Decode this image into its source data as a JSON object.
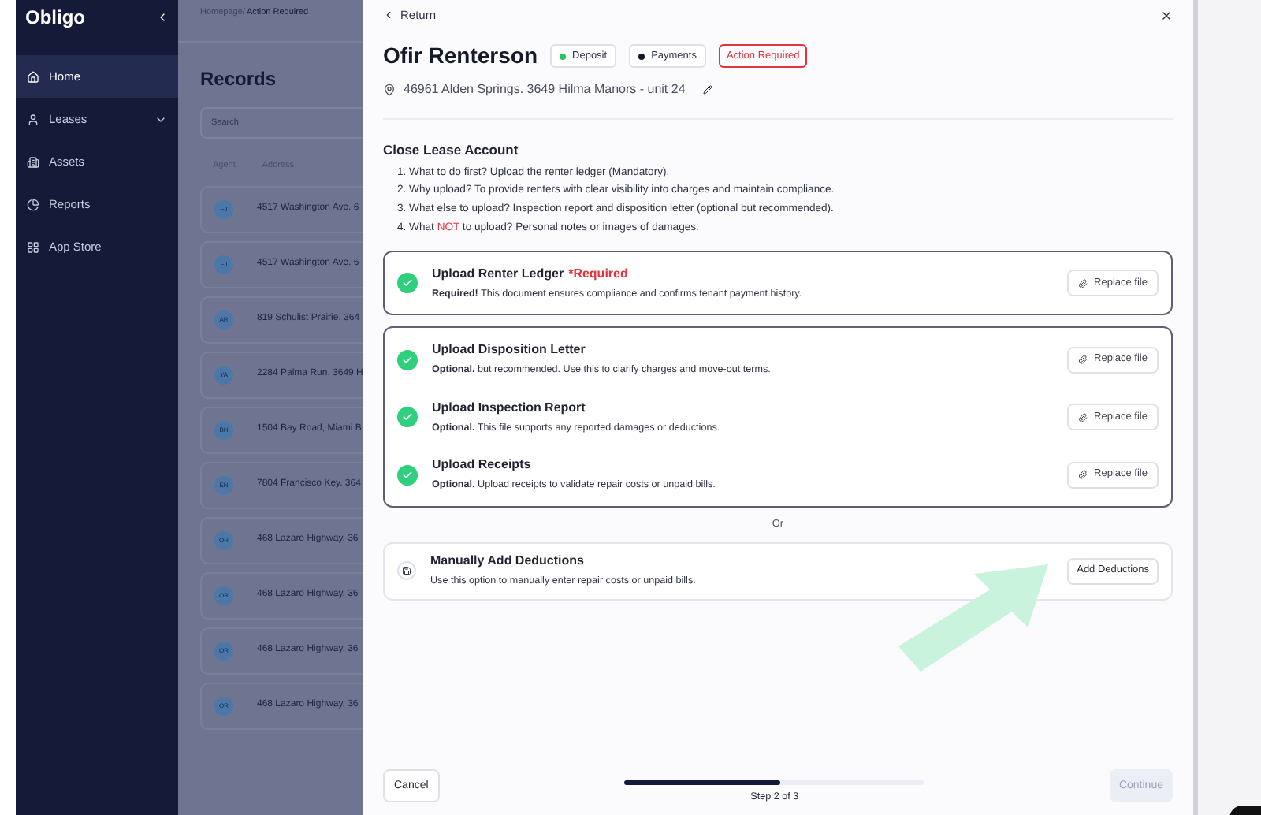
{
  "sidebar": {
    "logo": "Obligo",
    "items": [
      {
        "label": "Home",
        "selected": true,
        "expandable": false
      },
      {
        "label": "Leases",
        "selected": false,
        "expandable": true
      },
      {
        "label": "Assets",
        "selected": false,
        "expandable": false
      },
      {
        "label": "Reports",
        "selected": false,
        "expandable": false
      },
      {
        "label": "App Store",
        "selected": false,
        "expandable": false
      }
    ]
  },
  "background_page": {
    "breadcrumb": {
      "parent": "Homepage/",
      "current": "Action Required"
    },
    "title": "Records",
    "search": {
      "placeholder": "Search"
    },
    "columns": [
      "Agent",
      "Address"
    ],
    "rows": [
      {
        "agent": "FJ",
        "address": "4517 Washington Ave. 6"
      },
      {
        "agent": "FJ",
        "address": "4517 Washington Ave. 6"
      },
      {
        "agent": "AR",
        "address": "819 Schulist Prairie. 364"
      },
      {
        "agent": "YA",
        "address": "2284 Palma Run. 3649 H"
      },
      {
        "agent": "BH",
        "address": "1504 Bay Road, Miami B"
      },
      {
        "agent": "EN",
        "address": "7804 Francisco Key. 364"
      },
      {
        "agent": "OR",
        "address": "468 Lazaro Highway. 36"
      },
      {
        "agent": "OR",
        "address": "468 Lazaro Highway. 36"
      },
      {
        "agent": "OR",
        "address": "468 Lazaro Highway. 36"
      },
      {
        "agent": "OR",
        "address": "468 Lazaro Highway. 36"
      }
    ]
  },
  "modal": {
    "back": "Return",
    "name": "Ofir Renterson",
    "tags": [
      {
        "label": "Deposit",
        "kind": "dot",
        "color": "#22c55e"
      },
      {
        "label": "Payments",
        "kind": "dot",
        "color": "#111827"
      },
      {
        "label": "Action Required",
        "kind": "alert"
      }
    ],
    "address": "46961 Alden Springs. 3649 Hilma Manors - unit 24",
    "section_title": "Close Lease Account",
    "instructions": [
      [
        {
          "text": "1. What to do first? Upload the renter ledger (Mandatory).",
          "kind": "plain"
        }
      ],
      [
        {
          "text": "2. Why upload? To provide renters with clear visibility into charges and maintain compliance.",
          "kind": "plain"
        }
      ],
      [
        {
          "text": "3. What else to upload? Inspection report and disposition letter (optional but recommended).",
          "kind": "plain"
        }
      ],
      [
        {
          "text": "4. What ",
          "kind": "plain"
        },
        {
          "text": "NOT",
          "kind": "alert"
        },
        {
          "text": " to upload? Personal notes or images of damages.",
          "kind": "plain"
        }
      ]
    ],
    "upload_groups": [
      {
        "items": [
          {
            "title": "Upload Renter Ledger",
            "required": "*Required",
            "description": "**Required!** This document ensures compliance and confirms tenant payment history.",
            "done": true,
            "button": "Replace file"
          }
        ]
      },
      {
        "items": [
          {
            "title": "Upload Disposition Letter",
            "description": "**Optional.** but recommended. Use this to clarify charges and move-out terms.",
            "done": true,
            "button": "Replace file"
          },
          {
            "title": "Upload Inspection Report",
            "description": "**Optional.** This file supports any reported damages or deductions.",
            "done": true,
            "button": "Replace file"
          },
          {
            "title": "Upload Receipts",
            "description": "**Optional.** Upload receipts to validate repair costs or unpaid bills.",
            "done": true,
            "button": "Replace file"
          }
        ]
      }
    ],
    "separator": "Or",
    "manual": {
      "title": "Manually Add Deductions",
      "description": "Use this option to manually enter repair costs or unpaid bills.",
      "button": "Add Deductions"
    },
    "footer": {
      "cancel": "Cancel",
      "progress": {
        "level": 0.52
      },
      "step": "Step 2 of 3",
      "continue": {
        "label": "Continue",
        "disabled": true
      }
    }
  }
}
